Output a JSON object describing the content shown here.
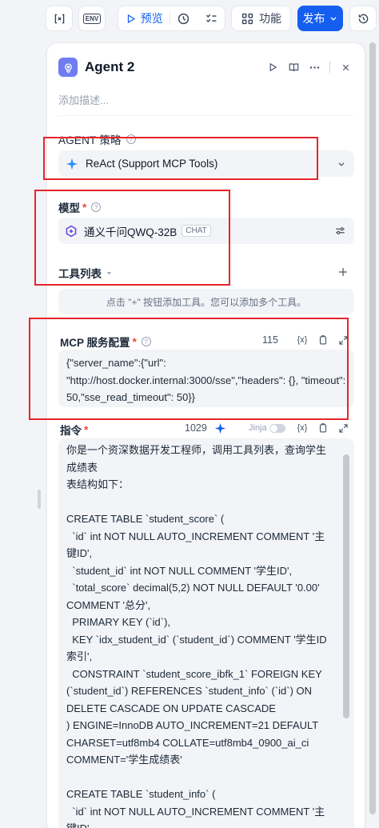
{
  "toolbar": {
    "env_label": "ENV",
    "preview_label": "预览",
    "features_label": "功能",
    "publish_label": "发布"
  },
  "agent": {
    "title": "Agent 2",
    "description_placeholder": "添加描述..."
  },
  "strategy": {
    "label": "AGENT 策略",
    "value": "ReAct (Support MCP Tools)"
  },
  "model": {
    "label": "模型",
    "required": "*",
    "name": "通义千问QWQ-32B",
    "badge": "CHAT"
  },
  "tools": {
    "label": "工具列表",
    "hint": "点击 \"+\" 按钮添加工具。您可以添加多个工具。"
  },
  "mcp": {
    "label": "MCP 服务配置",
    "required": "*",
    "count": "115",
    "value": "{\"server_name\":{\"url\": \"http://host.docker.internal:3000/sse\",\"headers\": {}, \"timeout\": 50,\"sse_read_timeout\": 50}}"
  },
  "instruction": {
    "label": "指令",
    "required": "*",
    "count": "1029",
    "jinja_label": "Jinja",
    "text": "你是一个资深数据开发工程师，调用工具列表，查询学生成绩表\n表结构如下：\n\nCREATE TABLE `student_score` (\n  `id` int NOT NULL AUTO_INCREMENT COMMENT '主键ID',\n  `student_id` int NOT NULL COMMENT '学生ID',\n  `total_score` decimal(5,2) NOT NULL DEFAULT '0.00' COMMENT '总分',\n  PRIMARY KEY (`id`),\n  KEY `idx_student_id` (`student_id`) COMMENT '学生ID索引',\n  CONSTRAINT `student_score_ibfk_1` FOREIGN KEY (`student_id`) REFERENCES `student_info` (`id`) ON DELETE CASCADE ON UPDATE CASCADE\n) ENGINE=InnoDB AUTO_INCREMENT=21 DEFAULT CHARSET=utf8mb4 COLLATE=utf8mb4_0900_ai_ci COMMENT='学生成绩表'\n\nCREATE TABLE `student_info` (\n  `id` int NOT NULL AUTO_INCREMENT COMMENT '主键ID',"
  },
  "colors": {
    "accent": "#155eef",
    "annotation": "#e8242b",
    "required": "#f04438"
  }
}
